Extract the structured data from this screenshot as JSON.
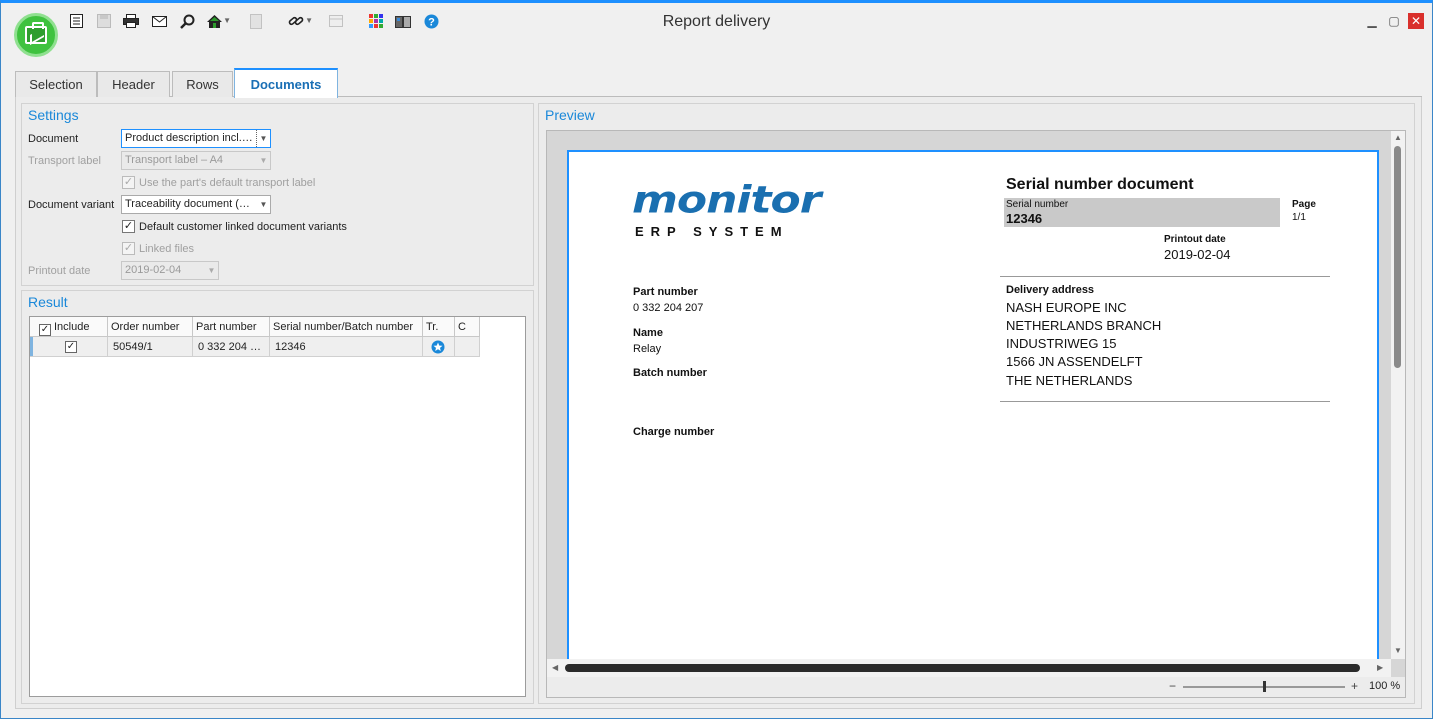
{
  "window": {
    "title": "Report delivery"
  },
  "toolbar": {
    "icons": [
      "list-icon",
      "save-icon",
      "print-icon",
      "mail-icon",
      "search-icon",
      "home-icon",
      "calculator-icon",
      "link-icon",
      "table-icon",
      "grid-color-icon",
      "book-icon",
      "help-icon"
    ]
  },
  "tabs": [
    {
      "label": "Selection"
    },
    {
      "label": "Header"
    },
    {
      "label": "Rows"
    },
    {
      "label": "Documents"
    }
  ],
  "settings": {
    "title": "Settings",
    "document_label": "Document",
    "document_value": "Product description incl.…",
    "transport_label": "Transport label",
    "transport_value": "Transport label – A4",
    "use_default_transport": "Use the part's default transport label",
    "variant_label": "Document variant",
    "variant_value": "Traceability document (…",
    "default_customer_variants": "Default customer linked document variants",
    "linked_files": "Linked files",
    "printout_date_label": "Printout date",
    "printout_date_value": "2019-02-04"
  },
  "result": {
    "title": "Result",
    "columns": [
      "Include",
      "Order number",
      "Part number",
      "Serial number/Batch number",
      "Tr.",
      "C"
    ],
    "rows": [
      {
        "include": true,
        "order_number": "50549/1",
        "part_number": "0 332 204 …",
        "serial": "12346"
      }
    ]
  },
  "preview": {
    "title": "Preview",
    "zoom": "100 %",
    "doc": {
      "logo_text": "monitor",
      "logo_sub": "ERP SYSTEM",
      "heading": "Serial number document",
      "serial_label": "Serial number",
      "serial_value": "12346",
      "page_label": "Page",
      "page_value": "1/1",
      "printout_label": "Printout date",
      "printout_value": "2019-02-04",
      "part_number_label": "Part number",
      "part_number_value": "0 332 204 207",
      "name_label": "Name",
      "name_value": "Relay",
      "batch_label": "Batch number",
      "charge_label": "Charge number",
      "delivery_label": "Delivery address",
      "address": [
        "NASH EUROPE INC",
        "NETHERLANDS BRANCH",
        "INDUSTRIWEG 15",
        "1566  JN ASSENDELFT",
        "THE NETHERLANDS"
      ]
    }
  }
}
